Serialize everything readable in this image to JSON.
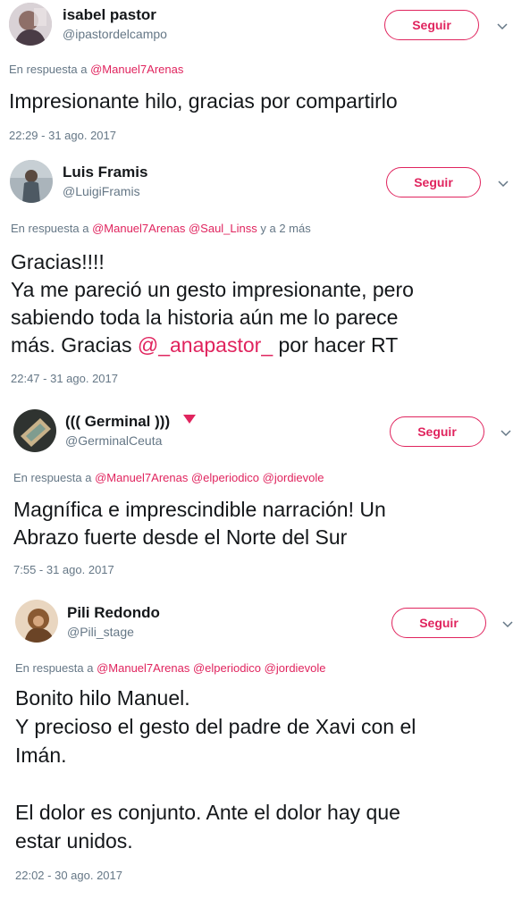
{
  "tweets": [
    {
      "name": "isabel pastor",
      "handle": "@ipastordelcampo",
      "follow_label": "Seguir",
      "reply_prefix": "En respuesta a",
      "reply_mentions": [
        "@Manuel7Arenas"
      ],
      "reply_suffix": "",
      "text_parts": [
        "Impresionante hilo, gracias por compartirlo"
      ],
      "timestamp": "22:29 - 31 ago. 2017",
      "avatar_color": "#b8a8b0"
    },
    {
      "name": "Luis Framis",
      "handle": "@LuigiFramis",
      "follow_label": "Seguir",
      "reply_prefix": "En respuesta a",
      "reply_mentions": [
        "@Manuel7Arenas",
        "@Saul_Linss"
      ],
      "reply_suffix": "y a 2 más",
      "text_before": "Gracias!!!!\nYa me pareció un gesto impresionante, pero\nsabiendo toda la historia aún me lo parece\nmás. Gracias ",
      "text_mention": "@_anapastor_",
      "text_after": " por hacer RT",
      "timestamp": "22:47 - 31 ago. 2017",
      "avatar_color": "#8a9aa6"
    },
    {
      "name": "((( Germinal )))",
      "handle": "@GerminalCeuta",
      "follow_label": "Seguir",
      "reply_prefix": "En respuesta a",
      "reply_mentions": [
        "@Manuel7Arenas",
        "@elperiodico",
        "@jordievole"
      ],
      "reply_suffix": "",
      "text_parts": [
        "Magnífica e imprescindible narración! Un\nAbrazo fuerte desde el Norte del Sur"
      ],
      "timestamp": "7:55 - 31 ago. 2017",
      "avatar_color": "#6f7c6a"
    },
    {
      "name": "Pili Redondo",
      "handle": "@Pili_stage",
      "follow_label": "Seguir",
      "reply_prefix": "En respuesta a",
      "reply_mentions": [
        "@Manuel7Arenas",
        "@elperiodico",
        "@jordievole"
      ],
      "reply_suffix": "",
      "text_parts": [
        "Bonito hilo Manuel.\nY precioso el gesto del padre de Xavi con el\nImán.\n\nEl dolor es conjunto. Ante el dolor hay que\nestar unidos."
      ],
      "timestamp": "22:02 - 30 ago. 2017",
      "avatar_color": "#9a6b45"
    }
  ],
  "icons": {
    "caret": "chevron-down-icon",
    "badge": "red-triangle-icon"
  },
  "colors": {
    "accent": "#e0245e",
    "secondary_text": "#657786",
    "primary_text": "#14171a"
  }
}
